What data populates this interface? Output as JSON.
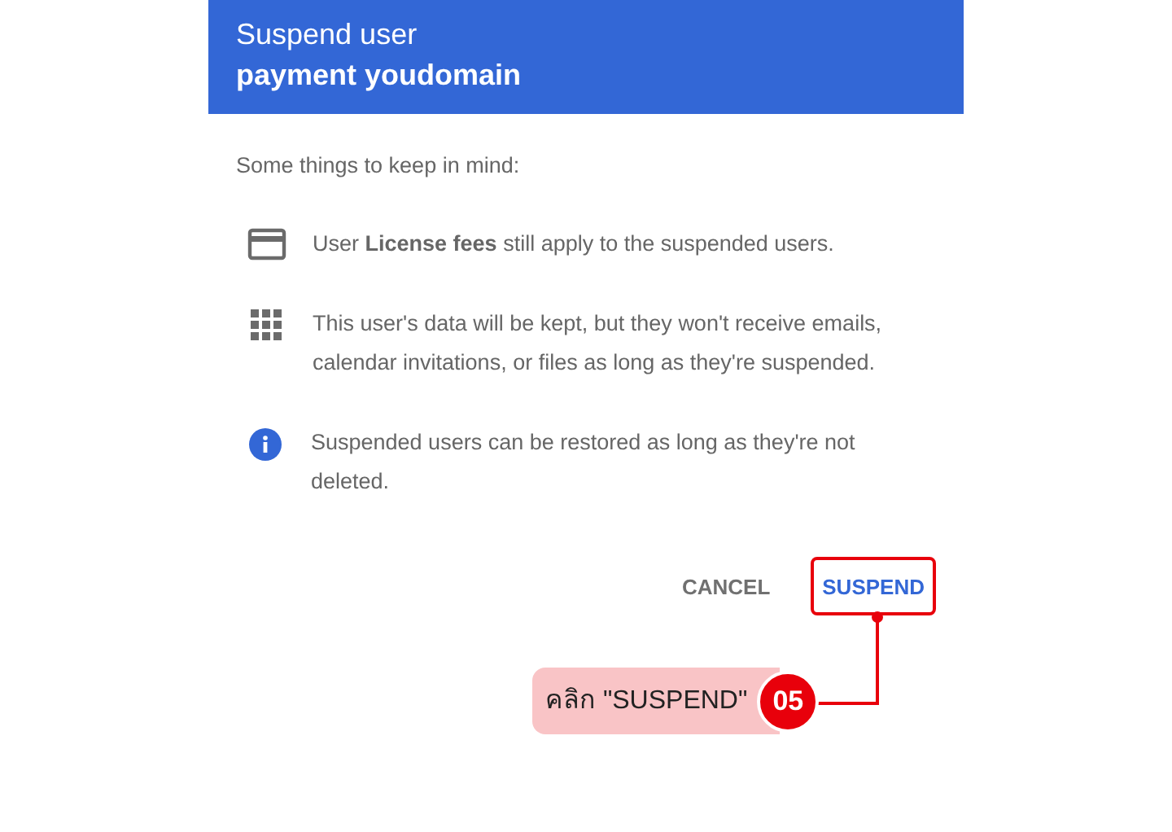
{
  "dialog": {
    "title": "Suspend user",
    "subtitle": "payment youdomain",
    "intro": "Some things to keep in mind:",
    "notes": [
      {
        "kind": "card",
        "text": "User **License fees** still apply to the suspended users."
      },
      {
        "kind": "apps",
        "text": "This user's data will be kept, but they won't receive emails, calendar invitations, or files as long as they're suspended."
      },
      {
        "kind": "info",
        "text": "Suspended users can be restored as long as they're not deleted."
      }
    ],
    "buttons": [
      {
        "label": "CANCEL",
        "kind": "plain",
        "highlighted": false
      },
      {
        "label": "SUSPEND",
        "kind": "primary",
        "highlighted": true
      }
    ]
  },
  "callout": {
    "label": "คลิก \"SUSPEND\"",
    "step": "05"
  }
}
